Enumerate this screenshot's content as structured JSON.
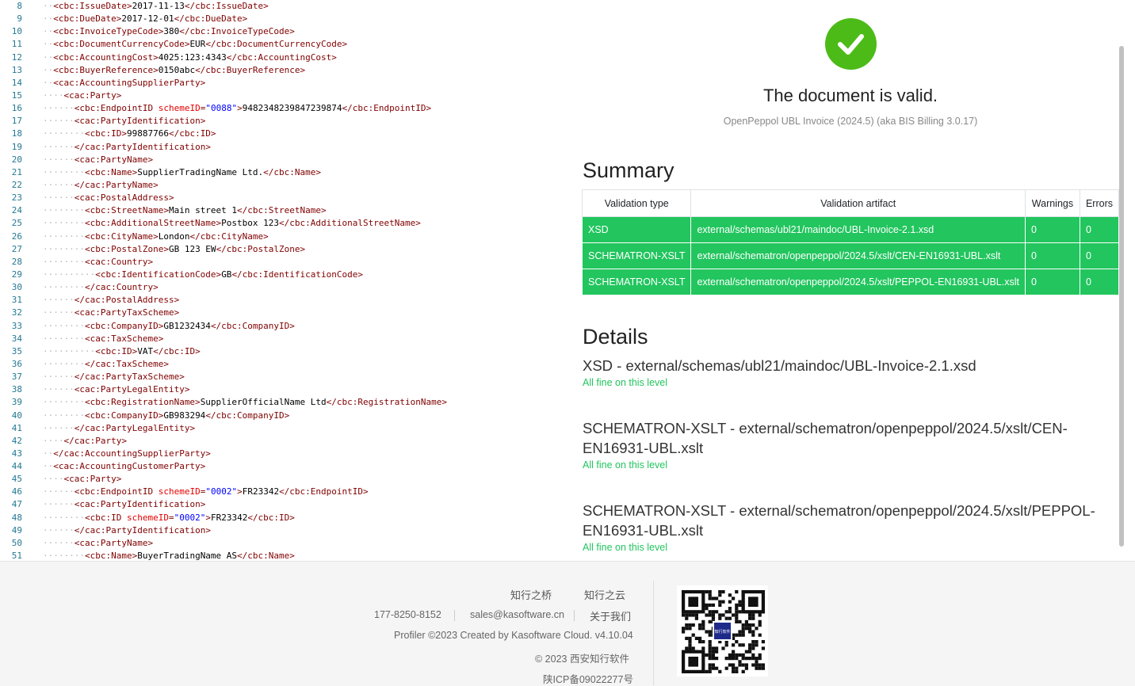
{
  "code": {
    "lines": [
      {
        "n": "8",
        "ind": "··",
        "c": [
          [
            "tag",
            "<cbc:IssueDate>"
          ],
          [
            "txt",
            "2017-11-13"
          ],
          [
            "tag",
            "</cbc:IssueDate>"
          ]
        ]
      },
      {
        "n": "9",
        "ind": "··",
        "c": [
          [
            "tag",
            "<cbc:DueDate>"
          ],
          [
            "txt",
            "2017-12-01"
          ],
          [
            "tag",
            "</cbc:DueDate>"
          ]
        ]
      },
      {
        "n": "10",
        "ind": "··",
        "c": [
          [
            "tag",
            "<cbc:InvoiceTypeCode>"
          ],
          [
            "txt",
            "380"
          ],
          [
            "tag",
            "</cbc:InvoiceTypeCode>"
          ]
        ]
      },
      {
        "n": "11",
        "ind": "··",
        "c": [
          [
            "tag",
            "<cbc:DocumentCurrencyCode>"
          ],
          [
            "txt",
            "EUR"
          ],
          [
            "tag",
            "</cbc:DocumentCurrencyCode>"
          ]
        ]
      },
      {
        "n": "12",
        "ind": "··",
        "c": [
          [
            "tag",
            "<cbc:AccountingCost>"
          ],
          [
            "txt",
            "4025:123:4343"
          ],
          [
            "tag",
            "</cbc:AccountingCost>"
          ]
        ]
      },
      {
        "n": "13",
        "ind": "··",
        "c": [
          [
            "tag",
            "<cbc:BuyerReference>"
          ],
          [
            "txt",
            "0150abc"
          ],
          [
            "tag",
            "</cbc:BuyerReference>"
          ]
        ]
      },
      {
        "n": "14",
        "ind": "··",
        "c": [
          [
            "tag",
            "<cac:AccountingSupplierParty>"
          ]
        ]
      },
      {
        "n": "15",
        "ind": "····",
        "c": [
          [
            "tag",
            "<cac:Party>"
          ]
        ]
      },
      {
        "n": "16",
        "ind": "······",
        "c": [
          [
            "tag",
            "<cbc:EndpointID "
          ],
          [
            "attr",
            "schemeID"
          ],
          [
            "tag",
            "="
          ],
          [
            "val",
            "\"0088\""
          ],
          [
            "tag",
            ">"
          ],
          [
            "txt",
            "9482348239847239874"
          ],
          [
            "tag",
            "</cbc:EndpointID>"
          ]
        ]
      },
      {
        "n": "17",
        "ind": "······",
        "c": [
          [
            "tag",
            "<cac:PartyIdentification>"
          ]
        ]
      },
      {
        "n": "18",
        "ind": "········",
        "c": [
          [
            "tag",
            "<cbc:ID>"
          ],
          [
            "txt",
            "99887766"
          ],
          [
            "tag",
            "</cbc:ID>"
          ]
        ]
      },
      {
        "n": "19",
        "ind": "······",
        "c": [
          [
            "tag",
            "</cac:PartyIdentification>"
          ]
        ]
      },
      {
        "n": "20",
        "ind": "······",
        "c": [
          [
            "tag",
            "<cac:PartyName>"
          ]
        ]
      },
      {
        "n": "21",
        "ind": "········",
        "c": [
          [
            "tag",
            "<cbc:Name>"
          ],
          [
            "txt",
            "SupplierTradingName Ltd."
          ],
          [
            "tag",
            "</cbc:Name>"
          ]
        ]
      },
      {
        "n": "22",
        "ind": "······",
        "c": [
          [
            "tag",
            "</cac:PartyName>"
          ]
        ]
      },
      {
        "n": "23",
        "ind": "······",
        "c": [
          [
            "tag",
            "<cac:PostalAddress>"
          ]
        ]
      },
      {
        "n": "24",
        "ind": "········",
        "c": [
          [
            "tag",
            "<cbc:StreetName>"
          ],
          [
            "txt",
            "Main street 1"
          ],
          [
            "tag",
            "</cbc:StreetName>"
          ]
        ]
      },
      {
        "n": "25",
        "ind": "········",
        "c": [
          [
            "tag",
            "<cbc:AdditionalStreetName>"
          ],
          [
            "txt",
            "Postbox 123"
          ],
          [
            "tag",
            "</cbc:AdditionalStreetName>"
          ]
        ]
      },
      {
        "n": "26",
        "ind": "········",
        "c": [
          [
            "tag",
            "<cbc:CityName>"
          ],
          [
            "txt",
            "London"
          ],
          [
            "tag",
            "</cbc:CityName>"
          ]
        ]
      },
      {
        "n": "27",
        "ind": "········",
        "c": [
          [
            "tag",
            "<cbc:PostalZone>"
          ],
          [
            "txt",
            "GB 123 EW"
          ],
          [
            "tag",
            "</cbc:PostalZone>"
          ]
        ]
      },
      {
        "n": "28",
        "ind": "········",
        "c": [
          [
            "tag",
            "<cac:Country>"
          ]
        ]
      },
      {
        "n": "29",
        "ind": "··········",
        "c": [
          [
            "tag",
            "<cbc:IdentificationCode>"
          ],
          [
            "txt",
            "GB"
          ],
          [
            "tag",
            "</cbc:IdentificationCode>"
          ]
        ]
      },
      {
        "n": "30",
        "ind": "········",
        "c": [
          [
            "tag",
            "</cac:Country>"
          ]
        ]
      },
      {
        "n": "31",
        "ind": "······",
        "c": [
          [
            "tag",
            "</cac:PostalAddress>"
          ]
        ]
      },
      {
        "n": "32",
        "ind": "······",
        "c": [
          [
            "tag",
            "<cac:PartyTaxScheme>"
          ]
        ]
      },
      {
        "n": "33",
        "ind": "········",
        "c": [
          [
            "tag",
            "<cbc:CompanyID>"
          ],
          [
            "txt",
            "GB1232434"
          ],
          [
            "tag",
            "</cbc:CompanyID>"
          ]
        ]
      },
      {
        "n": "34",
        "ind": "········",
        "c": [
          [
            "tag",
            "<cac:TaxScheme>"
          ]
        ]
      },
      {
        "n": "35",
        "ind": "··········",
        "c": [
          [
            "tag",
            "<cbc:ID>"
          ],
          [
            "txt",
            "VAT"
          ],
          [
            "tag",
            "</cbc:ID>"
          ]
        ]
      },
      {
        "n": "36",
        "ind": "········",
        "c": [
          [
            "tag",
            "</cac:TaxScheme>"
          ]
        ]
      },
      {
        "n": "37",
        "ind": "······",
        "c": [
          [
            "tag",
            "</cac:PartyTaxScheme>"
          ]
        ]
      },
      {
        "n": "38",
        "ind": "······",
        "c": [
          [
            "tag",
            "<cac:PartyLegalEntity>"
          ]
        ]
      },
      {
        "n": "39",
        "ind": "········",
        "c": [
          [
            "tag",
            "<cbc:RegistrationName>"
          ],
          [
            "txt",
            "SupplierOfficialName Ltd"
          ],
          [
            "tag",
            "</cbc:RegistrationName>"
          ]
        ]
      },
      {
        "n": "40",
        "ind": "········",
        "c": [
          [
            "tag",
            "<cbc:CompanyID>"
          ],
          [
            "txt",
            "GB983294"
          ],
          [
            "tag",
            "</cbc:CompanyID>"
          ]
        ]
      },
      {
        "n": "41",
        "ind": "······",
        "c": [
          [
            "tag",
            "</cac:PartyLegalEntity>"
          ]
        ]
      },
      {
        "n": "42",
        "ind": "····",
        "c": [
          [
            "tag",
            "</cac:Party>"
          ]
        ]
      },
      {
        "n": "43",
        "ind": "··",
        "c": [
          [
            "tag",
            "</cac:AccountingSupplierParty>"
          ]
        ]
      },
      {
        "n": "44",
        "ind": "··",
        "c": [
          [
            "tag",
            "<cac:AccountingCustomerParty>"
          ]
        ]
      },
      {
        "n": "45",
        "ind": "····",
        "c": [
          [
            "tag",
            "<cac:Party>"
          ]
        ]
      },
      {
        "n": "46",
        "ind": "······",
        "c": [
          [
            "tag",
            "<cbc:EndpointID "
          ],
          [
            "attr",
            "schemeID"
          ],
          [
            "tag",
            "="
          ],
          [
            "val",
            "\"0002\""
          ],
          [
            "tag",
            ">"
          ],
          [
            "txt",
            "FR23342"
          ],
          [
            "tag",
            "</cbc:EndpointID>"
          ]
        ]
      },
      {
        "n": "47",
        "ind": "······",
        "c": [
          [
            "tag",
            "<cac:PartyIdentification>"
          ]
        ]
      },
      {
        "n": "48",
        "ind": "········",
        "c": [
          [
            "tag",
            "<cbc:ID "
          ],
          [
            "attr",
            "schemeID"
          ],
          [
            "tag",
            "="
          ],
          [
            "val",
            "\"0002\""
          ],
          [
            "tag",
            ">"
          ],
          [
            "txt",
            "FR23342"
          ],
          [
            "tag",
            "</cbc:ID>"
          ]
        ]
      },
      {
        "n": "49",
        "ind": "······",
        "c": [
          [
            "tag",
            "</cac:PartyIdentification>"
          ]
        ]
      },
      {
        "n": "50",
        "ind": "······",
        "c": [
          [
            "tag",
            "<cac:PartyName>"
          ]
        ]
      },
      {
        "n": "51",
        "ind": "········",
        "c": [
          [
            "tag",
            "<cbc:Name>"
          ],
          [
            "txt",
            "BuyerTradingName AS"
          ],
          [
            "tag",
            "</cbc:Name>"
          ]
        ]
      }
    ]
  },
  "result": {
    "status_icon": "check-icon",
    "status_color": "#4cbb17",
    "title": "The document is valid.",
    "subtitle": "OpenPeppol UBL Invoice (2024.5) (aka BIS Billing 3.0.17)"
  },
  "summary": {
    "heading": "Summary",
    "columns": [
      "Validation type",
      "Validation artifact",
      "Warnings",
      "Errors"
    ],
    "row_color": "#22c55e",
    "rows": [
      {
        "type": "XSD",
        "artifact": "external/schemas/ubl21/maindoc/UBL-Invoice-2.1.xsd",
        "warnings": "0",
        "errors": "0"
      },
      {
        "type": "SCHEMATRON-XSLT",
        "artifact": "external/schematron/openpeppol/2024.5/xslt/CEN-EN16931-UBL.xslt",
        "warnings": "0",
        "errors": "0"
      },
      {
        "type": "SCHEMATRON-XSLT",
        "artifact": "external/schematron/openpeppol/2024.5/xslt/PEPPOL-EN16931-UBL.xslt",
        "warnings": "0",
        "errors": "0"
      }
    ]
  },
  "details": {
    "heading": "Details",
    "items": [
      {
        "title": "XSD - external/schemas/ubl21/maindoc/UBL-Invoice-2.1.xsd",
        "status": "All fine on this level"
      },
      {
        "title": "SCHEMATRON-XSLT - external/schematron/openpeppol/2024.5/xslt/CEN-EN16931-UBL.xslt",
        "status": "All fine on this level"
      },
      {
        "title": "SCHEMATRON-XSLT - external/schematron/openpeppol/2024.5/xslt/PEPPOL-EN16931-UBL.xslt",
        "status": "All fine on this level"
      }
    ]
  },
  "footer": {
    "link_bridge": "知行之桥",
    "link_cloud": "知行之云",
    "phone": "177-8250-8152",
    "email": "sales@kasoftware.cn",
    "about": "关于我们",
    "profiler": "Profiler ©2023 Created by Kasoftware Cloud. v4.10.04",
    "copyright": "© 2023 西安知行软件",
    "icp": "陕ICP备09022277号",
    "qr_label": "知行软件"
  }
}
